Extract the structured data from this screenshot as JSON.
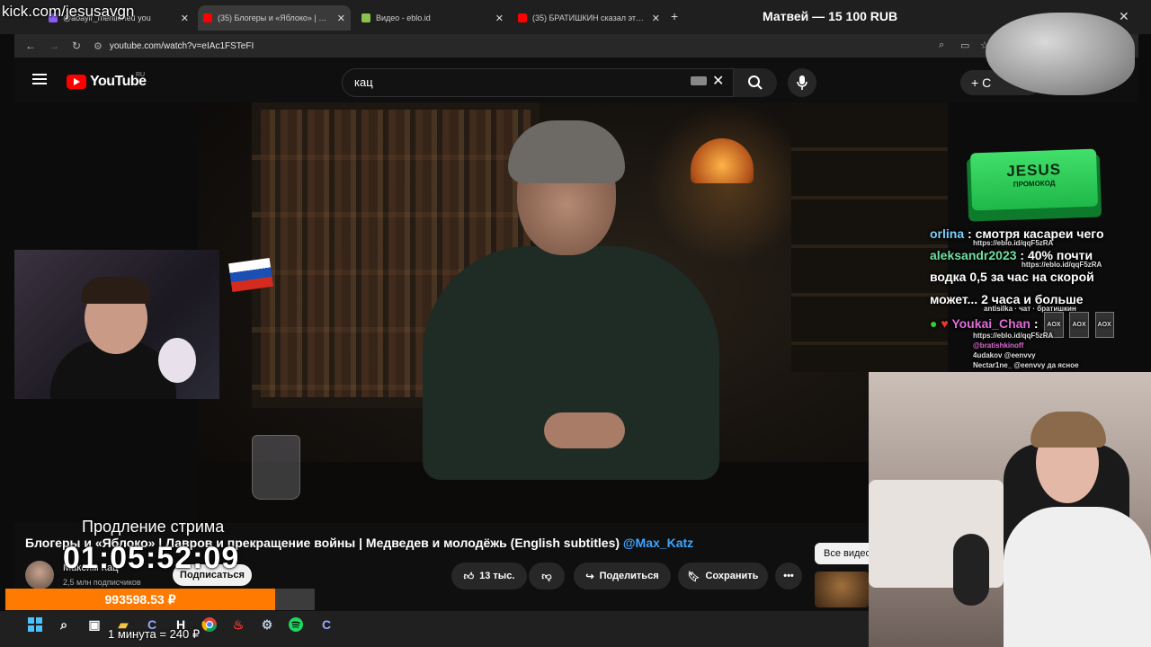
{
  "overlay": {
    "kick_url": "kick.com/jesusavgn",
    "prolong_label": "Продление стрима",
    "timer": "01:05:52:09",
    "money": "993598.53 ₽",
    "rate": "1 минута = 240 ₽",
    "promo_title": "JESUS",
    "promo_subtitle": "ПРОМОКОД",
    "top_donation": "Матвей — 15 100 RUB"
  },
  "browser": {
    "tabs": [
      {
        "label": "@aoayir_mentioned you",
        "icon": "kick-icon",
        "color": "#8a5cf6"
      },
      {
        "label": "(35) Блогеры и «Яблоко» | Лав",
        "icon": "youtube-icon",
        "color": "#ff0000"
      },
      {
        "label": "Видео - eblo.id",
        "icon": "eblo-icon",
        "color": "#8bc34a"
      },
      {
        "label": "(35) БРАТИШКИН сказал это п",
        "icon": "youtube-icon",
        "color": "#ff0000"
      }
    ],
    "url": "youtube.com/watch?v=eIAc1FSTeFI"
  },
  "youtube": {
    "logo_text": "YouTube",
    "region": "RU",
    "search_query": "кац",
    "create_label": "+ С",
    "video_title": "Блогеры и «Яблоко» | Лавров и прекращение войны | Медведев и молодёжь (English subtitles)",
    "video_handle": "@Max_Katz",
    "channel_name": "Максим Кац",
    "subscribers": "2,5 млн подписчиков",
    "subscribe_label": "Подписаться",
    "likes": "13 тыс.",
    "share_label": "Поделиться",
    "save_label": "Сохранить",
    "all_videos_label": "Все видео"
  },
  "chat": [
    {
      "user": "orlina",
      "text": ": смотря касареи чего",
      "sub": "https://eblo.id/qqF5zRA"
    },
    {
      "user": "aleksandr2023",
      "text": ": 40% почти",
      "sub": "https://eblo.id/qqF5zRA"
    },
    {
      "user": "",
      "text": "водка 0,5 за час на скорой",
      "sub": ""
    },
    {
      "user": "",
      "text": "может... 2 часа и больше",
      "sub": "antisilka · чат · братишкин"
    },
    {
      "user": "Youkai_Chan",
      "text": ":",
      "sub": "https://eblo.id/qqF5zRA"
    }
  ],
  "chat_small": [
    "@bratishkinoff",
    "4udakov @eenvvy",
    "Nectar1ne_ @eenvvy да ясное"
  ],
  "colors": {
    "accent": "#ff7a00",
    "youtube_red": "#ff0000",
    "link_blue": "#3ea6ff",
    "promo_green": "#2fcf5a"
  }
}
